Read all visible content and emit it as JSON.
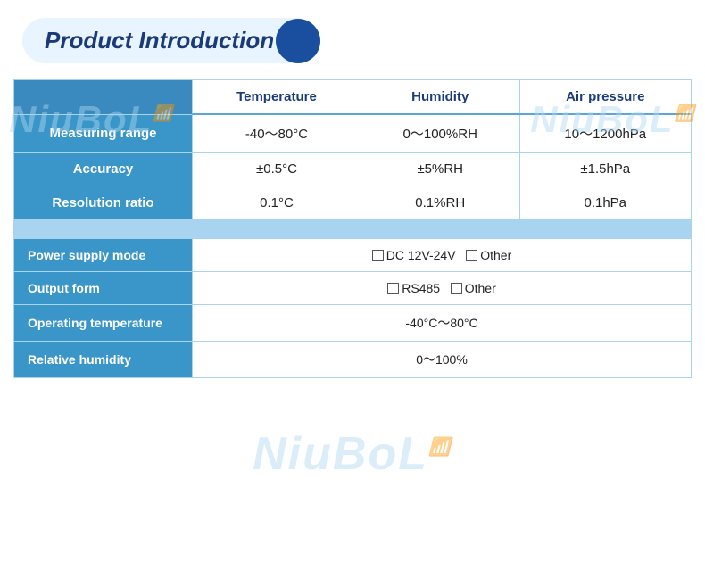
{
  "title": "Product Introduction",
  "watermark_text": "NiuBoL",
  "table": {
    "headers": {
      "col1": "",
      "col2": "Temperature",
      "col3": "Humidity",
      "col4": "Air pressure"
    },
    "rows": [
      {
        "label": "Measuring range",
        "temperature": "-40～80°C",
        "humidity": "0～100%RH",
        "air_pressure": "10～1200hPa"
      },
      {
        "label": "Accuracy",
        "temperature": "±0.5°C",
        "humidity": "±5%RH",
        "air_pressure": "±1.5hPa"
      },
      {
        "label": "Resolution ratio",
        "temperature": "0.1°C",
        "humidity": "0.1%RH",
        "air_pressure": "0.1hPa"
      }
    ],
    "full_rows": [
      {
        "label": "Power supply mode",
        "value": "DC 12V-24V  Other"
      },
      {
        "label": "Output form",
        "value": "RS485  Other"
      },
      {
        "label": "Operating temperature",
        "value": "-40°C～80°C"
      },
      {
        "label": "Relative humidity",
        "value": "0～100%"
      }
    ]
  }
}
